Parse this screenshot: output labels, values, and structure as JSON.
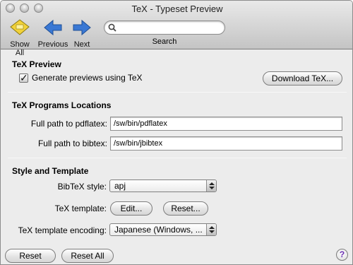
{
  "window": {
    "title": "TeX - Typeset Preview"
  },
  "toolbar": {
    "show_all": "Show All",
    "previous": "Previous",
    "next": "Next",
    "search_label": "Search",
    "search_value": ""
  },
  "preview": {
    "title": "TeX Preview",
    "checkbox_label": "Generate previews using TeX",
    "checked": true,
    "download_button": "Download TeX..."
  },
  "programs": {
    "title": "TeX Programs Locations",
    "pdflatex_label": "Full path to pdflatex:",
    "pdflatex_value": "/sw/bin/pdflatex",
    "bibtex_label": "Full path to bibtex:",
    "bibtex_value": "/sw/bin/jbibtex"
  },
  "style": {
    "title": "Style and Template",
    "bibtex_style_label": "BibTeX style:",
    "bibtex_style_value": "apj",
    "template_label": "TeX template:",
    "edit_button": "Edit...",
    "reset_button": "Reset...",
    "encoding_label": "TeX template encoding:",
    "encoding_value": "Japanese (Windows, ..."
  },
  "footer": {
    "reset": "Reset",
    "reset_all": "Reset All",
    "help": "?"
  },
  "colors": {
    "next_arrow": "#2f6fd0",
    "show_all_icon": "#f2d23a"
  }
}
